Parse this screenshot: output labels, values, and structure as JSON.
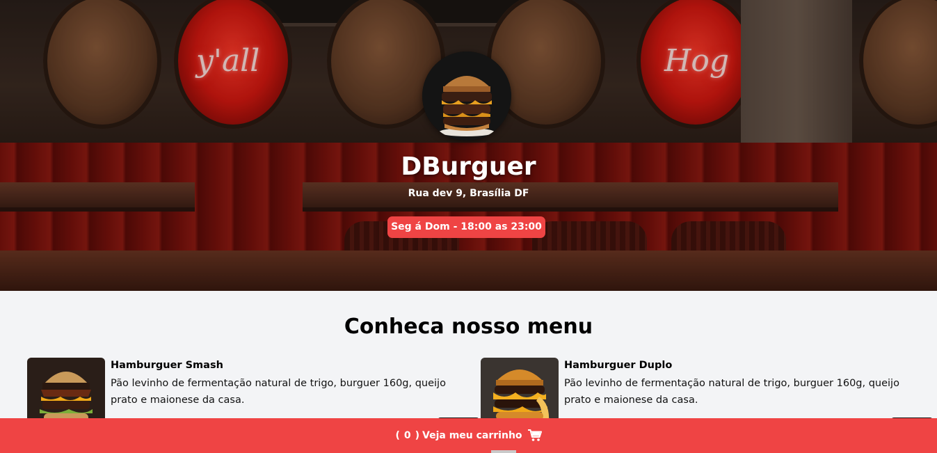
{
  "restaurant": {
    "name": "DBurguer",
    "address": "Rua dev 9, Brasília DF",
    "hours": "Seg á Dom - 18:00 as 23:00"
  },
  "decor": {
    "neon_left": "y'all",
    "neon_right": "Hog"
  },
  "menu": {
    "title": "Conheca nosso menu",
    "items": [
      {
        "name": "Hamburguer Smash",
        "description": "Pão levinho de fermentação natural de trigo, burguer 160g, queijo prato e maionese da casa."
      },
      {
        "name": "Hamburguer Duplo",
        "description": "Pão levinho de fermentação natural de trigo, burguer 160g, queijo prato e maionese da casa."
      }
    ]
  },
  "cart": {
    "open_paren": "(",
    "count": "0",
    "close_paren": ")",
    "label": "Veja meu carrinho",
    "icon": "shopping-cart-icon"
  },
  "colors": {
    "accent": "#ef4444",
    "background": "#f3f4f6"
  }
}
